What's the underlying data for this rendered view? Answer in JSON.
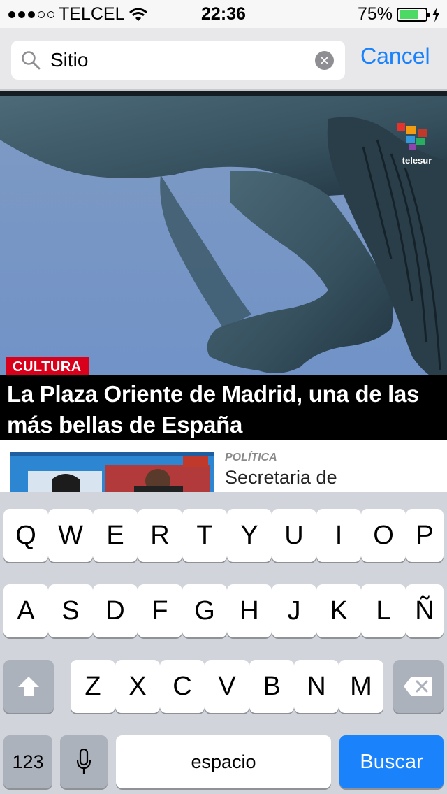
{
  "status_bar": {
    "carrier": "TELCEL",
    "time": "22:36",
    "battery_percent": "75%",
    "battery_level": 0.75,
    "signal_bars_filled": 3,
    "signal_bars_total": 5
  },
  "search": {
    "value": "Sitio",
    "cancel_label": "Cancel"
  },
  "hero": {
    "category": "CULTURA",
    "title": "La Plaza Oriente de Madrid, una de las más bellas de España",
    "logo_text": "telesur"
  },
  "article": {
    "category": "POLÍTICA",
    "title": "Secretaria de"
  },
  "keyboard": {
    "row1": [
      "Q",
      "W",
      "E",
      "R",
      "T",
      "Y",
      "U",
      "I",
      "O",
      "P"
    ],
    "row2": [
      "A",
      "S",
      "D",
      "F",
      "G",
      "H",
      "J",
      "K",
      "L",
      "Ñ"
    ],
    "row3": [
      "Z",
      "X",
      "C",
      "V",
      "B",
      "N",
      "M"
    ],
    "numbers_label": "123",
    "space_label": "espacio",
    "search_label": "Buscar"
  },
  "colors": {
    "accent": "#1a82fb",
    "badge": "#d9001b",
    "battery": "#4cd964"
  },
  "icons": [
    "search-icon",
    "clear-icon",
    "wifi-icon",
    "charging-icon",
    "shift-icon",
    "backspace-icon",
    "microphone-icon"
  ]
}
